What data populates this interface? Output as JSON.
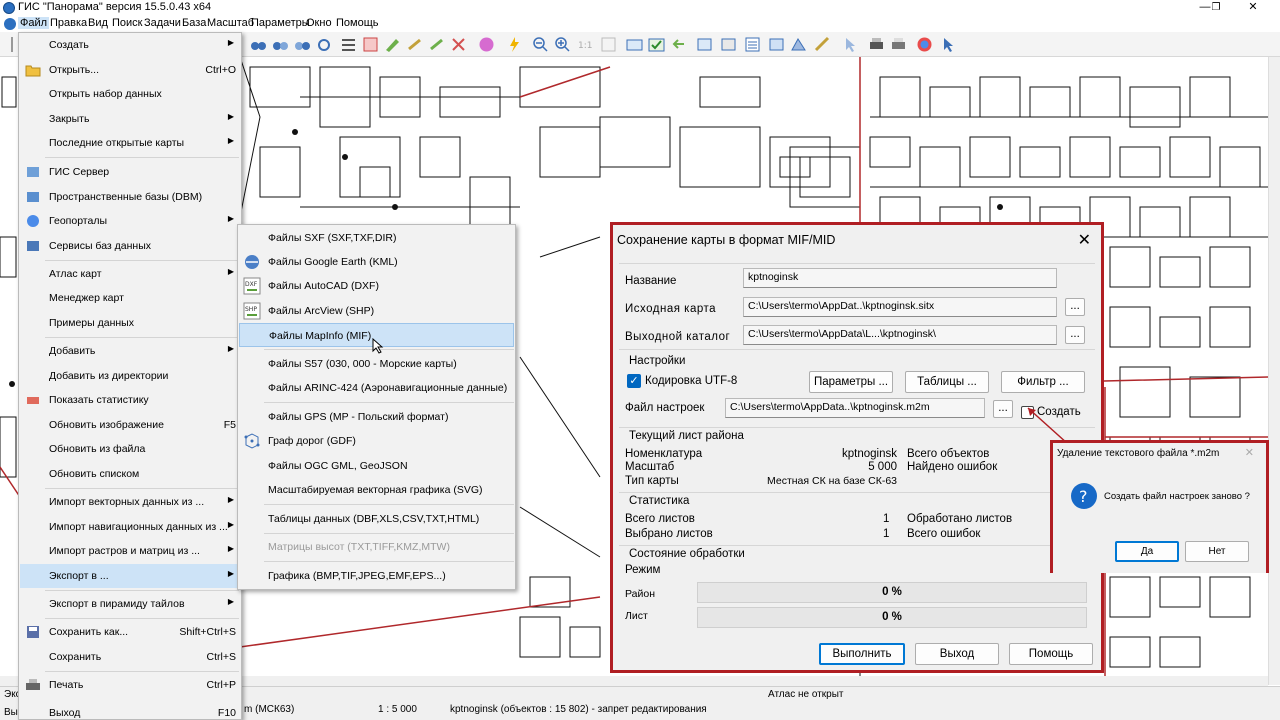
{
  "app": {
    "title": "ГИС \"Панорама\" версия 15.5.0.43 x64",
    "minimize": "—",
    "restore": "❐",
    "close": "✕"
  },
  "menubar": [
    "Файл",
    "Правка",
    "Вид",
    "Поиск",
    "Задачи",
    "База",
    "Масштаб",
    "Параметры",
    "Окно",
    "Помощь"
  ],
  "file_menu": [
    {
      "label": "Создать",
      "shortcut": "",
      "arrow": true,
      "icon": ""
    },
    {
      "label": "Открыть...",
      "shortcut": "Ctrl+O",
      "arrow": false,
      "icon": "open-folder-icon"
    },
    {
      "label": "Открыть набор данных",
      "shortcut": "",
      "arrow": false,
      "icon": ""
    },
    {
      "label": "Закрыть",
      "shortcut": "",
      "arrow": true,
      "icon": ""
    },
    {
      "label": "Последние открытые карты",
      "shortcut": "",
      "arrow": true,
      "icon": ""
    },
    {
      "label": "ГИС Сервер",
      "shortcut": "",
      "arrow": false,
      "icon": "gis-server-icon"
    },
    {
      "label": "Пространственные базы (DBM)",
      "shortcut": "",
      "arrow": false,
      "icon": "database-icon"
    },
    {
      "label": "Геопорталы",
      "shortcut": "",
      "arrow": true,
      "icon": "geoportal-icon"
    },
    {
      "label": "Сервисы баз данных",
      "shortcut": "",
      "arrow": false,
      "icon": "db-services-icon"
    },
    {
      "label": "Атлас карт",
      "shortcut": "",
      "arrow": true,
      "icon": ""
    },
    {
      "label": "Менеджер карт",
      "shortcut": "",
      "arrow": false,
      "icon": ""
    },
    {
      "label": "Примеры данных",
      "shortcut": "",
      "arrow": false,
      "icon": ""
    },
    {
      "label": "Добавить",
      "shortcut": "",
      "arrow": true,
      "icon": ""
    },
    {
      "label": "Добавить из директории",
      "shortcut": "",
      "arrow": false,
      "icon": ""
    },
    {
      "label": "Показать статистику",
      "shortcut": "",
      "arrow": false,
      "icon": "statistics-icon"
    },
    {
      "label": "Обновить изображение",
      "shortcut": "F5",
      "arrow": false,
      "icon": ""
    },
    {
      "label": "Обновить из файла",
      "shortcut": "",
      "arrow": false,
      "icon": ""
    },
    {
      "label": "Обновить списком",
      "shortcut": "",
      "arrow": false,
      "icon": ""
    },
    {
      "label": "Импорт векторных данных из ...",
      "shortcut": "",
      "arrow": true,
      "icon": ""
    },
    {
      "label": "Импорт навигационных данных из ...",
      "shortcut": "",
      "arrow": true,
      "icon": ""
    },
    {
      "label": "Импорт растров и матриц из ...",
      "shortcut": "",
      "arrow": true,
      "icon": ""
    },
    {
      "label": "Экспорт в ...",
      "shortcut": "",
      "arrow": true,
      "icon": ""
    },
    {
      "label": "Экспорт в пирамиду тайлов",
      "shortcut": "",
      "arrow": true,
      "icon": ""
    },
    {
      "label": "Сохранить как...",
      "shortcut": "Shift+Ctrl+S",
      "arrow": false,
      "icon": "save-icon"
    },
    {
      "label": "Сохранить",
      "shortcut": "Ctrl+S",
      "arrow": false,
      "icon": ""
    },
    {
      "label": "Печать",
      "shortcut": "Ctrl+P",
      "arrow": false,
      "icon": "printer-icon"
    },
    {
      "label": "Выход",
      "shortcut": "F10",
      "arrow": false,
      "icon": ""
    }
  ],
  "export_submenu": [
    {
      "label": "Файлы SXF (SXF,TXF,DIR)",
      "icon": ""
    },
    {
      "label": "Файлы Google Earth (KML)",
      "icon": "google-earth-icon"
    },
    {
      "label": "Файлы AutoCAD (DXF)",
      "icon": "dxf-icon"
    },
    {
      "label": "Файлы ArcView (SHP)",
      "icon": "shp-icon"
    },
    {
      "label": "Файлы MapInfo (MIF)",
      "icon": ""
    },
    {
      "label": "Файлы S57 (030, 000 - Морские карты)",
      "icon": ""
    },
    {
      "label": "Файлы ARINC-424 (Аэронавигационные данные)",
      "icon": ""
    },
    {
      "label": "Файлы GPS (MP - Польский формат)",
      "icon": ""
    },
    {
      "label": "Граф дорог (GDF)",
      "icon": "road-graph-icon"
    },
    {
      "label": "Файлы OGC GML, GeoJSON",
      "icon": ""
    },
    {
      "label": "Масштабируемая векторная графика (SVG)",
      "icon": ""
    },
    {
      "label": "Таблицы данных (DBF,XLS,CSV,TXT,HTML)",
      "icon": ""
    },
    {
      "label": "Матрицы высот (TXT,TIFF,KMZ,MTW)",
      "icon": ""
    },
    {
      "label": "Графика (BMP,TIF,JPEG,EMF,EPS...)",
      "icon": ""
    }
  ],
  "dialog": {
    "title": "Сохранение карты в формат MIF/MID",
    "name_label": "Название",
    "name_value": "kptnoginsk",
    "source_label": "Исходная карта",
    "source_value": "C:\\Users\\termo\\AppDat..\\kptnoginsk.sitx",
    "output_label": "Выходной каталог",
    "output_value": "C:\\Users\\termo\\AppData\\L...\\kptnoginsk\\",
    "browse": "...",
    "settings_group": "Настройки",
    "utf8_label": "Кодировка UTF-8",
    "utf8_checked": true,
    "params_button": "Параметры ...",
    "tables_button": "Таблицы ...",
    "filter_button": "Фильтр ...",
    "settings_file_label": "Файл настроек",
    "settings_file_value": "C:\\Users\\termo\\AppData..\\kptnoginsk.m2m",
    "create_label": "Создать",
    "create_checked": false,
    "sheet_group": "Текущий лист района",
    "nomenclature_label": "Номенклатура",
    "nomenclature_value": "kptnoginsk",
    "scale_label": "Масштаб",
    "scale_value": "5 000",
    "maptype_label": "Тип карты",
    "maptype_value": "Местная СК на базе СК-63",
    "total_objects_label": "Всего объектов",
    "errors_found_label": "Найдено ошибок",
    "stats_group": "Статистика",
    "total_sheets_label": "Всего листов",
    "total_sheets_value": "1",
    "selected_sheets_label": "Выбрано листов",
    "selected_sheets_value": "1",
    "processed_label": "Обработано листов",
    "total_errors_label": "Всего ошибок",
    "state_group": "Состояние обработки",
    "mode_label": "Режим",
    "region_label": "Район",
    "region_progress": "0 %",
    "region_fraction": 0,
    "sheet_label": "Лист",
    "sheet_progress": "0 %",
    "sheet_fraction": 0,
    "run_button": "Выполнить",
    "exit_button": "Выход",
    "help_button": "Помощь"
  },
  "message": {
    "title": "Удаление текстового файла *.m2m",
    "text": "Создать файл настроек заново ?",
    "yes": "Да",
    "no": "Нет"
  },
  "status": {
    "left": "Экс",
    "left2": "Вых",
    "coord_system": "m  (МСК63)",
    "scale": "1 : 5 000",
    "map_info": "kptnoginsk   (объектов : 15 802) - запрет редактирования",
    "atlas": "Атлас не открыт"
  },
  "colors": {
    "accent": "#0078d4",
    "highlight_frame": "#b01e23",
    "menu_highlight": "#cde3f7",
    "map_line": "#111111",
    "map_boundary": "#b0282b"
  }
}
